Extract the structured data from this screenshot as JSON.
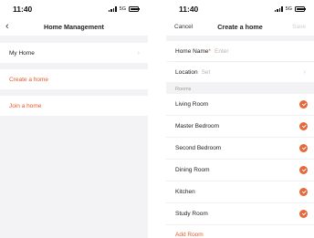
{
  "left": {
    "status_time": "11:40",
    "status_network": "5G",
    "title": "Home Management",
    "my_home_label": "My Home",
    "create_home_label": "Create a home",
    "join_home_label": "Join a home"
  },
  "right": {
    "status_time": "11:40",
    "status_network": "5G",
    "title": "Create a home",
    "cancel_label": "Cancel",
    "save_label": "Save",
    "home_name_label": "Home Name",
    "home_name_required": "*",
    "home_name_placeholder": "Enter",
    "location_label": "Location",
    "location_value": "Set",
    "rooms_section_label": "Rooms",
    "rooms": [
      {
        "name": "Living Room",
        "checked": true
      },
      {
        "name": "Master Bedroom",
        "checked": true
      },
      {
        "name": "Second Bedroom",
        "checked": true
      },
      {
        "name": "Dining Room",
        "checked": true
      },
      {
        "name": "Kitchen",
        "checked": true
      },
      {
        "name": "Study Room",
        "checked": true
      }
    ],
    "add_room_label": "Add Room"
  },
  "colors": {
    "accent": "#e8582b",
    "background": "#f3f3f5"
  }
}
